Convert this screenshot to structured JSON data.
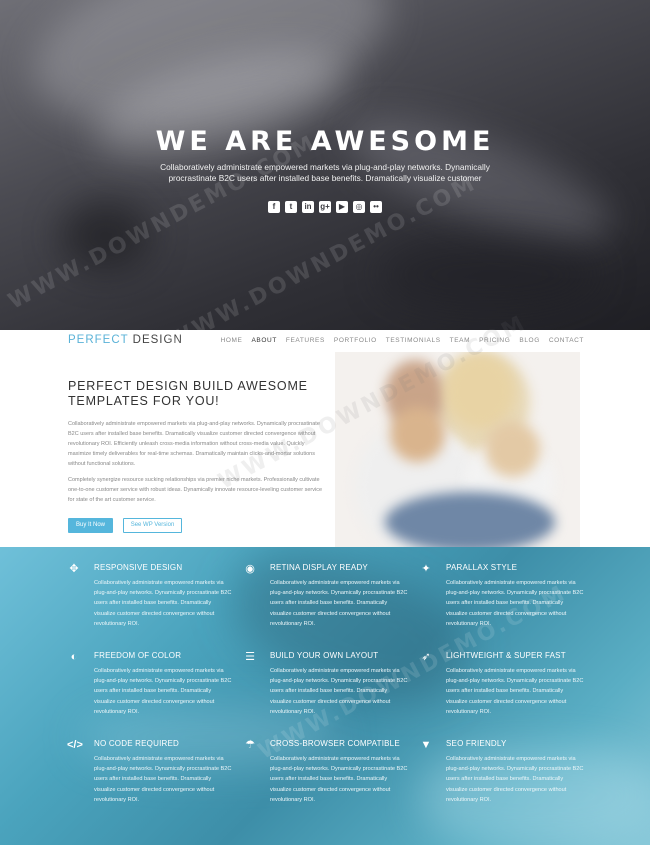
{
  "hero": {
    "title": "WE ARE AWESOME",
    "subtitle": "Collaboratively administrate empowered markets via plug-and-play networks. Dynamically procrastinate B2C users after installed base benefits. Dramatically visualize customer",
    "social_icons": [
      {
        "name": "facebook-icon",
        "glyph": "f"
      },
      {
        "name": "twitter-icon",
        "glyph": "t"
      },
      {
        "name": "linkedin-icon",
        "glyph": "in"
      },
      {
        "name": "google-plus-icon",
        "glyph": "g+"
      },
      {
        "name": "youtube-icon",
        "glyph": "▶"
      },
      {
        "name": "instagram-icon",
        "glyph": "◎"
      },
      {
        "name": "flickr-icon",
        "glyph": "••"
      }
    ]
  },
  "nav": {
    "logo_part1": "PERFECT",
    "logo_part2": " DESIGN",
    "items": [
      "HOME",
      "ABOUT",
      "FEATURES",
      "PORTFOLIO",
      "TESTIMONIALS",
      "TEAM",
      "PRICING",
      "BLOG",
      "CONTACT"
    ],
    "active": "ABOUT"
  },
  "intro": {
    "title": "PERFECT DESIGN BUILD AWESOME TEMPLATES FOR YOU!",
    "paragraph1": "Collaboratively administrate empowered markets via plug-and-play networks. Dynamically procrastinate B2C users after installed base benefits. Dramatically visualize customer directed convergence without revolutionary ROI. Efficiently unleash cross-media information without cross-media value. Quickly maximize timely deliverables for real-time schemas. Dramatically maintain clicks-and-mortar solutions without functional solutions.",
    "paragraph2": "Completely synergize resource sucking relationships via premier niche markets. Professionally cultivate one-to-one customer service with robust ideas. Dynamically innovate resource-leveling customer service for state of the art customer service.",
    "buy_button": "Buy It Now",
    "wp_button": "See WP Version"
  },
  "features": [
    {
      "icon": "arrows-move-icon",
      "glyph": "✥",
      "title": "RESPONSIVE DESIGN",
      "text": "Collaboratively administrate empowered markets via plug-and-play networks. Dynamically procrastinate B2C users after installed base benefits. Dramatically visualize customer directed convergence without revolutionary ROI."
    },
    {
      "icon": "eye-icon",
      "glyph": "◉",
      "title": "RETINA DISPLAY READY",
      "text": "Collaboratively administrate empowered markets via plug-and-play networks. Dynamically procrastinate B2C users after installed base benefits. Dramatically visualize customer directed convergence without revolutionary ROI."
    },
    {
      "icon": "magic-wand-icon",
      "glyph": "✦",
      "title": "PARALLAX STYLE",
      "text": "Collaboratively administrate empowered markets via plug-and-play networks. Dynamically procrastinate B2C users after installed base benefits. Dramatically visualize customer directed convergence without revolutionary ROI."
    },
    {
      "icon": "contrast-icon",
      "glyph": "◐",
      "title": "FREEDOM OF COLOR",
      "text": "Collaboratively administrate empowered markets via plug-and-play networks. Dynamically procrastinate B2C users after installed base benefits. Dramatically visualize customer directed convergence without revolutionary ROI."
    },
    {
      "icon": "list-icon",
      "glyph": "☰",
      "title": "BUILD YOUR OWN LAYOUT",
      "text": "Collaboratively administrate empowered markets via plug-and-play networks. Dynamically procrastinate B2C users after installed base benefits. Dramatically visualize customer directed convergence without revolutionary ROI."
    },
    {
      "icon": "rocket-icon",
      "glyph": "➶",
      "title": "LIGHTWEIGHT & SUPER FAST",
      "text": "Collaboratively administrate empowered markets via plug-and-play networks. Dynamically procrastinate B2C users after installed base benefits. Dramatically visualize customer directed convergence without revolutionary ROI."
    },
    {
      "icon": "code-icon",
      "glyph": "</>",
      "title": "NO CODE REQUIRED",
      "text": "Collaboratively administrate empowered markets via plug-and-play networks. Dynamically procrastinate B2C users after installed base benefits. Dramatically visualize customer directed convergence without revolutionary ROI."
    },
    {
      "icon": "umbrella-icon",
      "glyph": "☂",
      "title": "CROSS-BROWSER COMPATIBLE",
      "text": "Collaboratively administrate empowered markets via plug-and-play networks. Dynamically procrastinate B2C users after installed base benefits. Dramatically visualize customer directed convergence without revolutionary ROI."
    },
    {
      "icon": "filter-icon",
      "glyph": "▼",
      "title": "SEO FRIENDLY",
      "text": "Collaboratively administrate empowered markets via plug-and-play networks. Dynamically procrastinate B2C users after installed base benefits. Dramatically visualize customer directed convergence without revolutionary ROI."
    }
  ],
  "watermark": "WWW.DOWNDEMO.COM"
}
